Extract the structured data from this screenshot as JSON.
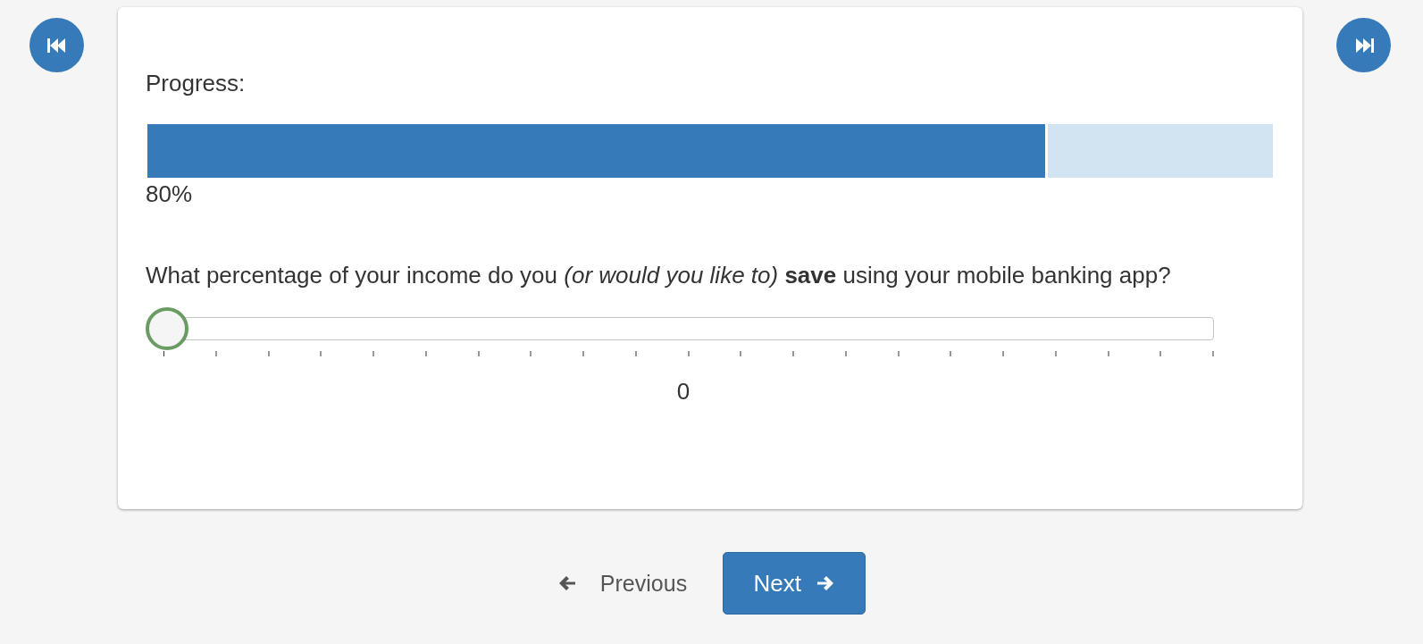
{
  "progress": {
    "label": "Progress:",
    "level": 0.8,
    "reading": "80%"
  },
  "question": {
    "text": "What percentage of your income do you *(or would you like to)* **save** using your mobile banking app?",
    "slider": {
      "level": 0,
      "reading": "0"
    }
  },
  "buttons": {
    "previous": "Previous",
    "next": "Next"
  }
}
